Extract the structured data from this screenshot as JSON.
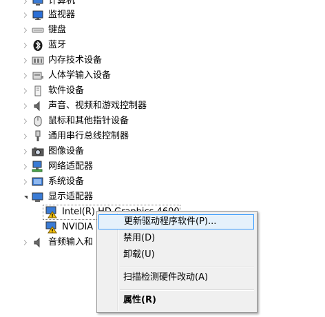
{
  "device_tree": {
    "items": [
      {
        "label": "计算机",
        "icon": "computer-icon",
        "state": "collapsed"
      },
      {
        "label": "监视器",
        "icon": "monitor-icon",
        "state": "collapsed"
      },
      {
        "label": "键盘",
        "icon": "keyboard-icon",
        "state": "collapsed"
      },
      {
        "label": "蓝牙",
        "icon": "bluetooth-icon",
        "state": "collapsed"
      },
      {
        "label": "内存技术设备",
        "icon": "memory-device-icon",
        "state": "collapsed"
      },
      {
        "label": "人体学输入设备",
        "icon": "hid-icon",
        "state": "collapsed"
      },
      {
        "label": "软件设备",
        "icon": "software-device-icon",
        "state": "collapsed"
      },
      {
        "label": "声音、视频和游戏控制器",
        "icon": "speaker-icon",
        "state": "collapsed"
      },
      {
        "label": "鼠标和其他指针设备",
        "icon": "mouse-icon",
        "state": "collapsed"
      },
      {
        "label": "通用串行总线控制器",
        "icon": "usb-icon",
        "state": "collapsed"
      },
      {
        "label": "图像设备",
        "icon": "camera-icon",
        "state": "collapsed"
      },
      {
        "label": "网络适配器",
        "icon": "network-icon",
        "state": "collapsed"
      },
      {
        "label": "系统设备",
        "icon": "system-device-icon",
        "state": "collapsed"
      },
      {
        "label": "显示适配器",
        "icon": "display-adapter-icon",
        "state": "expanded"
      },
      {
        "label": "Intel(R) HD Graphics 4600",
        "icon": "warning-display-icon",
        "state": "child"
      },
      {
        "label": "NVIDIA",
        "icon": "warning-display-icon",
        "state": "child"
      },
      {
        "label": "音频输入和",
        "icon": "audio-icon",
        "state": "collapsed"
      }
    ]
  },
  "context_menu": {
    "items": [
      {
        "label": "更新驱动程序软件(P)...",
        "hover": true
      },
      {
        "label": "禁用(D)"
      },
      {
        "label": "卸载(U)"
      },
      {
        "label": "扫描检测硬件改动(A)"
      },
      {
        "label": "属性(R)",
        "bold": true
      }
    ]
  },
  "colors": {
    "menu_highlight": "#e5f1fb",
    "menu_highlight_border": "#3399ff",
    "warning": "#f4c20d"
  }
}
